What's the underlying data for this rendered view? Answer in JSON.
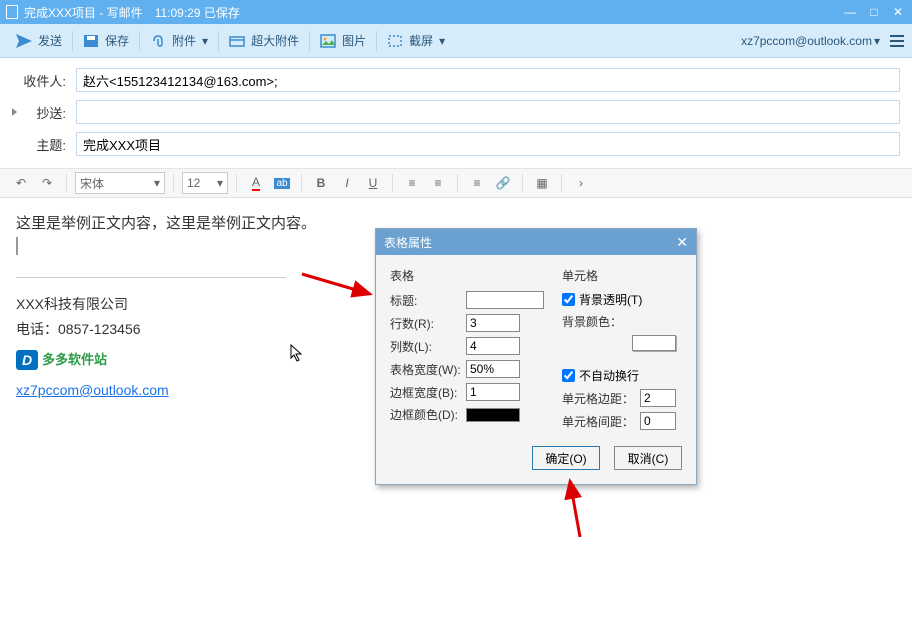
{
  "window": {
    "title": "完成XXX项目 - 写邮件",
    "timestamp": "11:09:29 已保存"
  },
  "toolbar": {
    "send": "发送",
    "save": "保存",
    "attach": "附件",
    "bigattach": "超大附件",
    "image": "图片",
    "screenshot": "截屏",
    "account": "xz7pccom@outlook.com"
  },
  "fields": {
    "to_label": "收件人:",
    "to_value": "赵六<155123412134@163.com>;",
    "cc_label": "抄送:",
    "cc_value": "",
    "subject_label": "主题:",
    "subject_value": "完成XXX项目"
  },
  "editor": {
    "font_name": "宋体",
    "font_size": "12",
    "body_text": "这里是举例正文内容，这里是举例正文内容。",
    "sig_company": "XXX科技有限公司",
    "sig_phone_label": "电话：",
    "sig_phone": "0857-123456",
    "sig_brand": "多多软件站",
    "sig_email": "xz7pccom@outlook.com"
  },
  "dialog": {
    "title": "表格属性",
    "table_section": "表格",
    "caption_label": "标题:",
    "caption_value": "",
    "rows_label": "行数(R):",
    "rows_value": "3",
    "cols_label": "列数(L):",
    "cols_value": "4",
    "width_label": "表格宽度(W):",
    "width_value": "50%",
    "border_label": "边框宽度(B):",
    "border_value": "1",
    "bordercolor_label": "边框颜色(D):",
    "cell_section": "单元格",
    "bg_transparent_label": "背景透明(T)",
    "bg_color_label": "背景颜色：",
    "nowrap_label": "不自动换行",
    "cellpadding_label": "单元格边距：",
    "cellpadding_value": "2",
    "cellspacing_label": "单元格间距：",
    "cellspacing_value": "0",
    "ok": "确定(O)",
    "cancel": "取消(C)"
  }
}
